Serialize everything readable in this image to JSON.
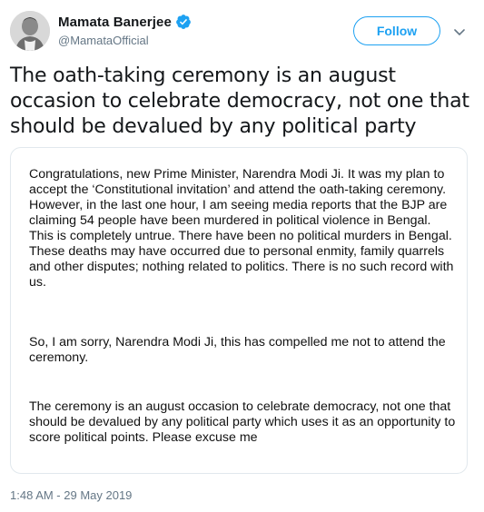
{
  "user": {
    "display_name": "Mamata Banerjee",
    "handle": "@MamataOfficial",
    "verified": true,
    "avatar_icon": "profile-photo"
  },
  "actions": {
    "follow_label": "Follow",
    "more_icon": "chevron-down-icon"
  },
  "tweet": {
    "text": "The oath-taking ceremony is an august occasion to celebrate democracy, not one that should be devalued by any political party",
    "timestamp": "1:48 AM - 29 May 2019"
  },
  "attached_image": {
    "paragraphs": [
      "Congratulations, new Prime Minister, Narendra Modi Ji. It was my plan to accept the ‘Constitutional invitation’ and attend the oath-taking ceremony. However, in the last one hour, I am seeing media reports that the BJP are claiming 54 people have been murdered in political violence in Bengal. This is completely untrue. There have been no political murders in Bengal. These deaths may have occurred due to personal enmity, family quarrels and other disputes; nothing related to politics. There is no such record with us.",
      "So, I am sorry, Narendra Modi Ji, this has compelled me not to attend the ceremony.",
      "The ceremony is an august occasion to celebrate democracy, not one that should be devalued by any political party which uses it as an opportunity to score political points. Please excuse me"
    ]
  },
  "colors": {
    "accent": "#1da1f2",
    "secondary_text": "#657786",
    "primary_text": "#14171a",
    "border": "#e1e8ed"
  }
}
